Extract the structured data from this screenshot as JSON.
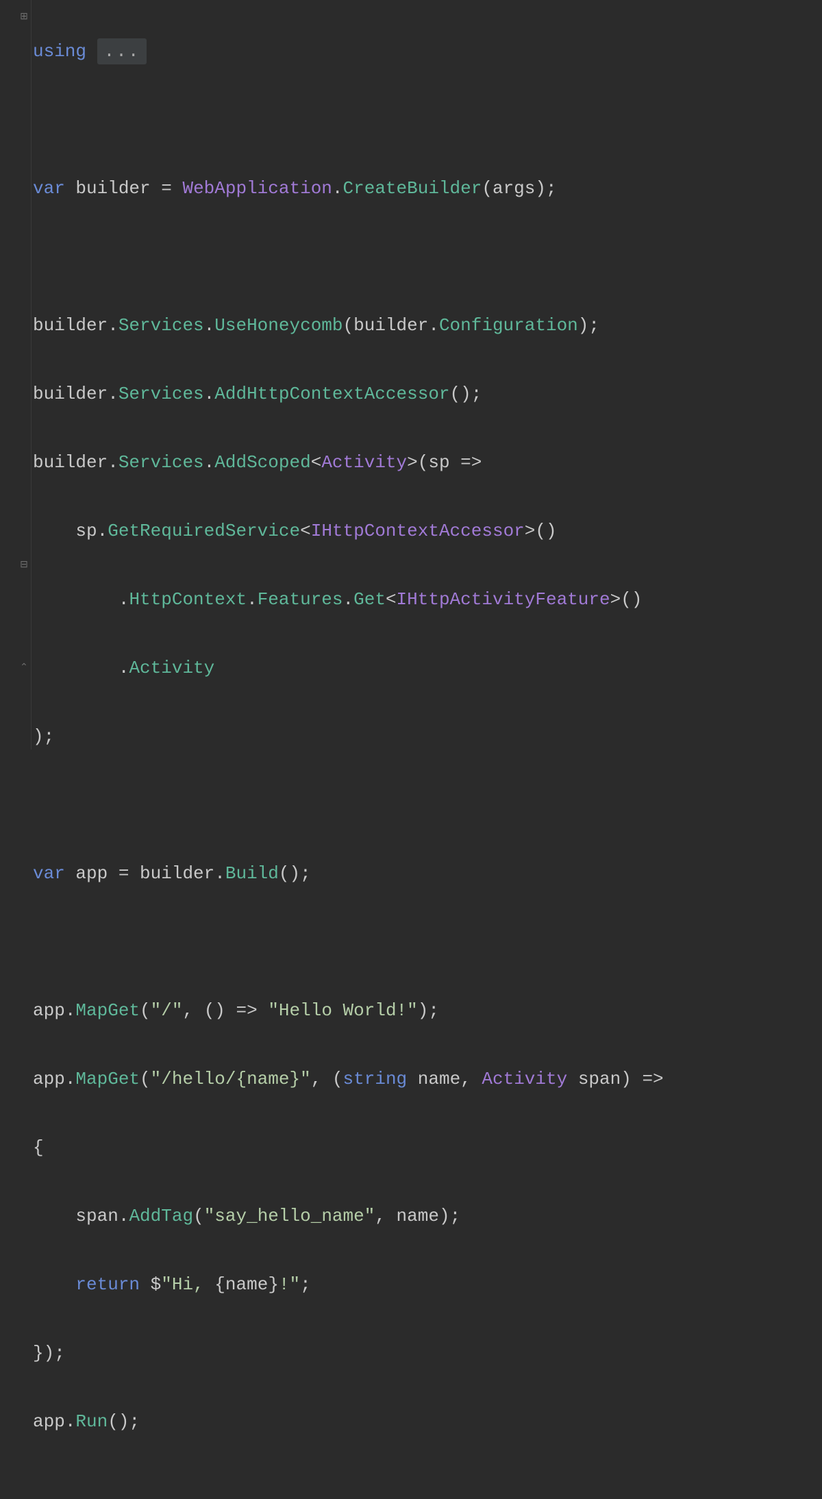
{
  "colors": {
    "background": "#2b2b2b",
    "keyword": "#6a8bd6",
    "type": "#a17ad6",
    "method": "#5fb89a",
    "string": "#b5cea8",
    "default": "#c9c9c9",
    "gutterIcon": "#6e6e6e",
    "badgeBg": "#3c3f41"
  },
  "folding_badge": "...",
  "tokens": {
    "using": "using",
    "var1": "var",
    "builder_ident": " builder ",
    "eq": "=",
    "space": " ",
    "WebApplication": "WebApplication",
    "dot": ".",
    "CreateBuilder": "CreateBuilder",
    "lparen": "(",
    "args": "args",
    "rparen": ")",
    "semi": ";",
    "builder": "builder",
    "Services": "Services",
    "UseHoneycomb": "UseHoneycomb",
    "Configuration": "Configuration",
    "AddHttpContextAccessor": "AddHttpContextAccessor",
    "AddScoped": "AddScoped",
    "lt": "<",
    "gt": ">",
    "Activity": "Activity",
    "sp": "sp",
    "arrow": " =>",
    "GetRequiredService": "GetRequiredService",
    "IHttpContextAccessor": "IHttpContextAccessor",
    "HttpContext": "HttpContext",
    "Features": "Features",
    "Get": "Get",
    "IHttpActivityFeature": "IHttpActivityFeature",
    "Activity_prop": "Activity",
    "var2": "var",
    "app_ident": " app ",
    "Build": "Build",
    "app": "app",
    "MapGet": "MapGet",
    "str_root": "\"/\"",
    "paren_empty": "()",
    "str_hello_world": "\"Hello World!\"",
    "str_hello_name_route": "\"/hello/{name}\"",
    "string_kw": "string",
    "name_ident": " name",
    "comma": ", ",
    "Activity_type2": "Activity",
    "span_ident": " span",
    "lbrace": "{",
    "span": "span",
    "AddTag": "AddTag",
    "str_say_hello": "\"say_hello_name\"",
    "name": "name",
    "return": "return",
    "dollar": " $",
    "str_hi_open": "\"Hi, ",
    "interp_open": "{",
    "interp_close": "}",
    "str_hi_close": "!\"",
    "rbrace": "}",
    "Run": "Run",
    "indent1": "    ",
    "indent2": "        "
  }
}
